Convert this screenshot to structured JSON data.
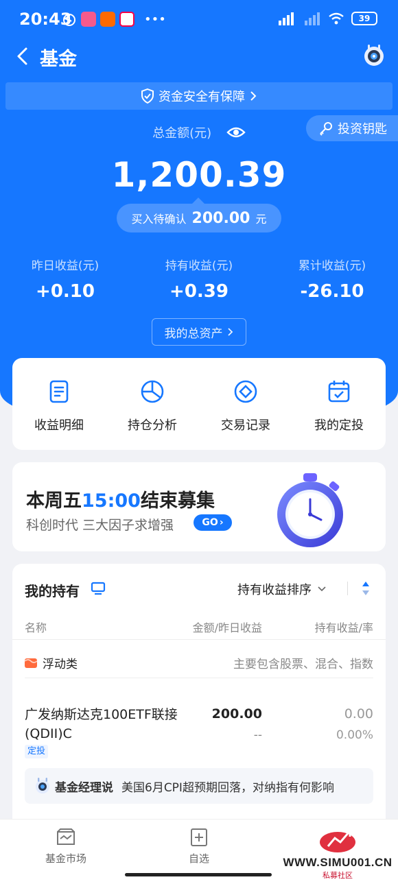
{
  "status": {
    "time": "20:43",
    "battery": "39"
  },
  "nav": {
    "title": "基金"
  },
  "security": {
    "label": "资金安全有保障"
  },
  "key_button": {
    "label": "投资钥匙"
  },
  "summary": {
    "total_label": "总金额(元)",
    "total_amount": "1,200.39",
    "pending_label": "买入待确认",
    "pending_value": "200.00",
    "pending_unit": "元"
  },
  "stats": [
    {
      "label": "昨日收益(元)",
      "value": "+0.10"
    },
    {
      "label": "持有收益(元)",
      "value": "+0.39"
    },
    {
      "label": "累计收益(元)",
      "value": "-26.10"
    }
  ],
  "assets_button": {
    "label": "我的总资产"
  },
  "quick_actions": [
    {
      "label": "收益明细",
      "icon": "document-icon"
    },
    {
      "label": "持仓分析",
      "icon": "pie-chart-icon"
    },
    {
      "label": "交易记录",
      "icon": "coin-icon"
    },
    {
      "label": "我的定投",
      "icon": "calendar-check-icon"
    }
  ],
  "promo": {
    "title_prefix": "本周五",
    "title_highlight": "15:00",
    "title_suffix": "结束募集",
    "subtitle": "科创时代 三大因子求增强",
    "go_label": "GO"
  },
  "holdings": {
    "title": "我的持有",
    "sort_label": "持有收益排序",
    "columns": {
      "name": "名称",
      "amount": "金额/昨日收益",
      "profit": "持有收益/率"
    },
    "category": {
      "name": "浮动类",
      "description": "主要包含股票、混合、指数"
    },
    "funds": [
      {
        "name": "广发纳斯达克100ETF联接(QDII)C",
        "tag": "定投",
        "amount": "200.00",
        "yesterday": "--",
        "profit": "0.00",
        "rate": "0.00%"
      }
    ],
    "manager_note": {
      "title": "基金经理说",
      "text": "美国6月CPI超预期回落，对纳指有何影响"
    }
  },
  "tabbar": [
    {
      "label": "基金市场",
      "icon": "market-icon"
    },
    {
      "label": "自选",
      "icon": "add-watchlist-icon"
    }
  ],
  "watermark": {
    "text": "WWW.SIMU001.CN",
    "sub": "私募社区"
  },
  "colors": {
    "primary": "#1677ff",
    "background": "#f1f2f6"
  }
}
